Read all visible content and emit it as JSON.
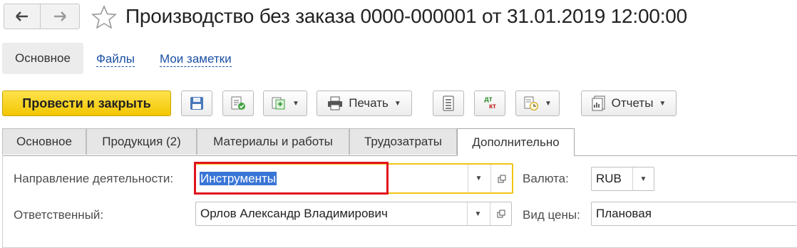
{
  "window": {
    "title": "Производство без заказа 0000-000001 от 31.01.2019 12:00:00",
    "back_glyph": "🡐",
    "forward_glyph": "🡒"
  },
  "sections": {
    "main": "Основное",
    "files": "Файлы",
    "notes": "Мои заметки"
  },
  "toolbar": {
    "post_close": "Провести и закрыть",
    "print": "Печать",
    "reports": "Отчеты",
    "dt_kt_top": "дт",
    "dt_kt_bottom": "кт"
  },
  "tabs": [
    {
      "label": "Основное"
    },
    {
      "label": "Продукция (2)"
    },
    {
      "label": "Материалы и работы"
    },
    {
      "label": "Трудозатраты"
    },
    {
      "label": "Дополнительно"
    }
  ],
  "active_tab": "Дополнительно",
  "form": {
    "direction_label": "Направление деятельности:",
    "direction_value": "Инструменты",
    "responsible_label": "Ответственный:",
    "responsible_value": "Орлов Александр Владимирович",
    "currency_label": "Валюта:",
    "currency_value": "RUB",
    "price_type_label": "Вид цены:",
    "price_type_value": "Плановая"
  },
  "colors": {
    "primary_button": "#f2c600",
    "focus_border": "#f0c419",
    "annotation_box": "#e0141e",
    "selection": "#3a75d6",
    "link": "#1a4fa3"
  }
}
